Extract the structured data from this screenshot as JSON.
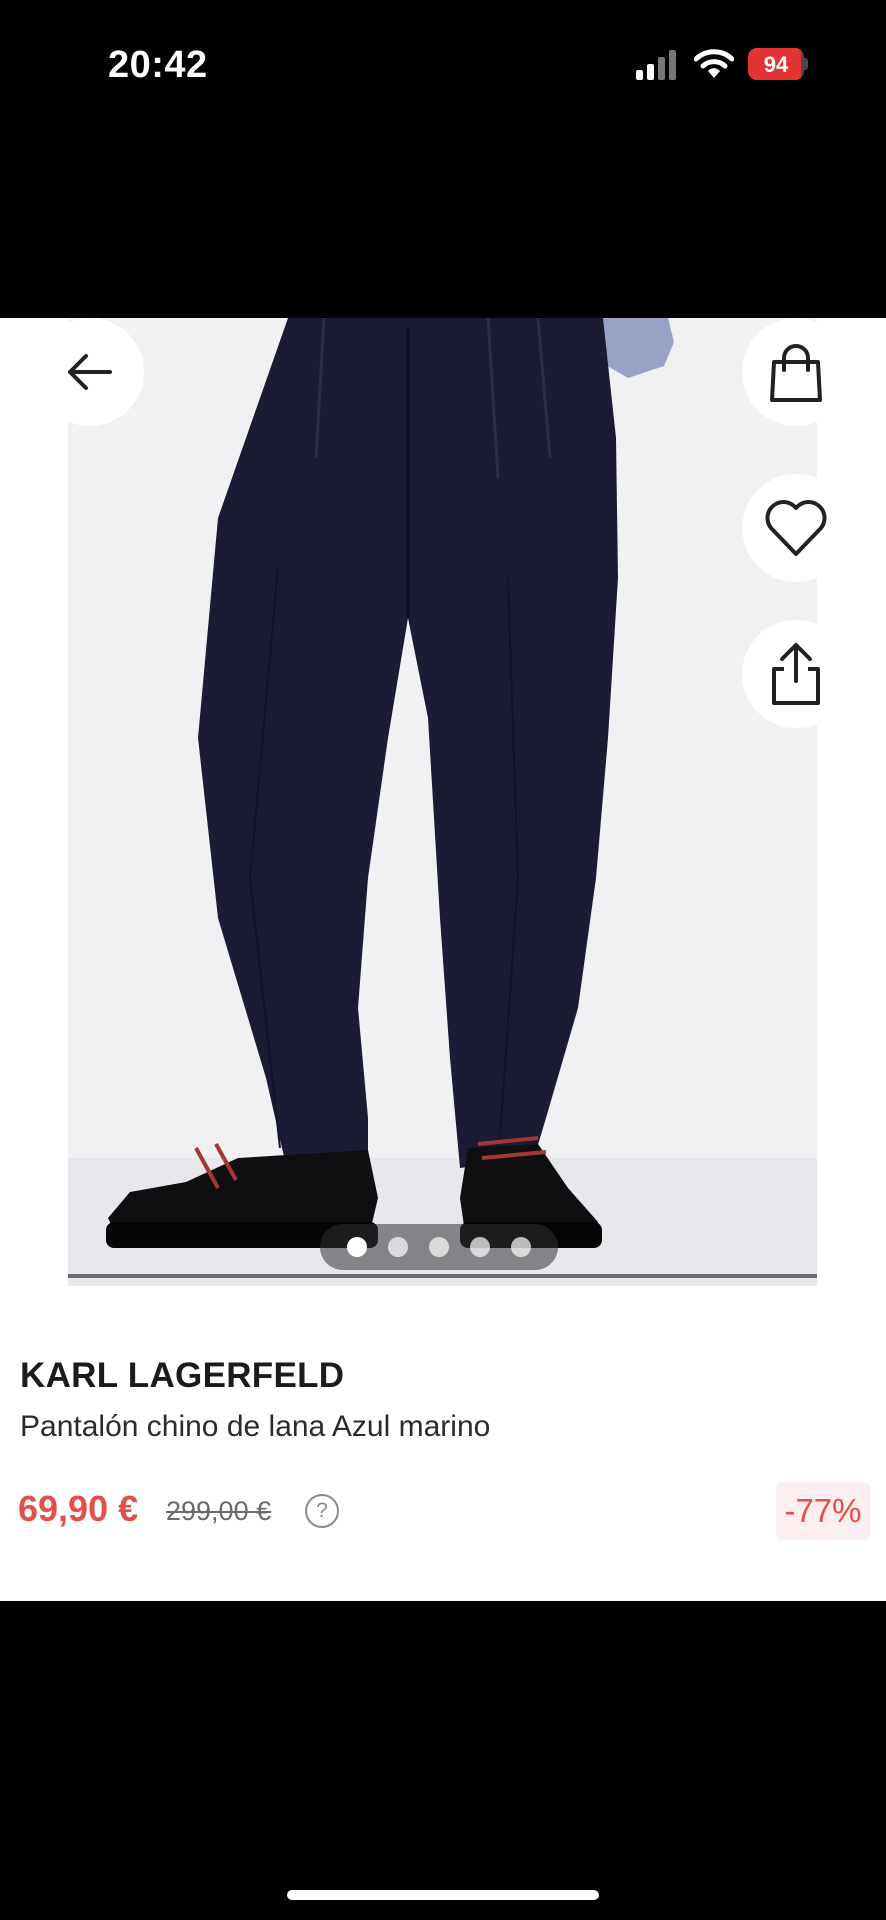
{
  "status_bar": {
    "time": "20:42",
    "battery": "94",
    "battery_level": 0.94,
    "battery_color": "#e33333"
  },
  "gallery": {
    "image_count": 5,
    "active_index": 0,
    "icons": [
      "back-arrow-icon",
      "shopping-bag-icon",
      "heart-icon",
      "share-icon"
    ]
  },
  "product": {
    "brand": "KARL LAGERFELD",
    "name": "Pantalón chino de lana Azul marino",
    "price": "69,90 €",
    "old_price": "299,00 €",
    "help_symbol": "?",
    "discount": "-77%"
  },
  "colors": {
    "sale_red": "#e2504a",
    "text": "#1b1b1b"
  }
}
